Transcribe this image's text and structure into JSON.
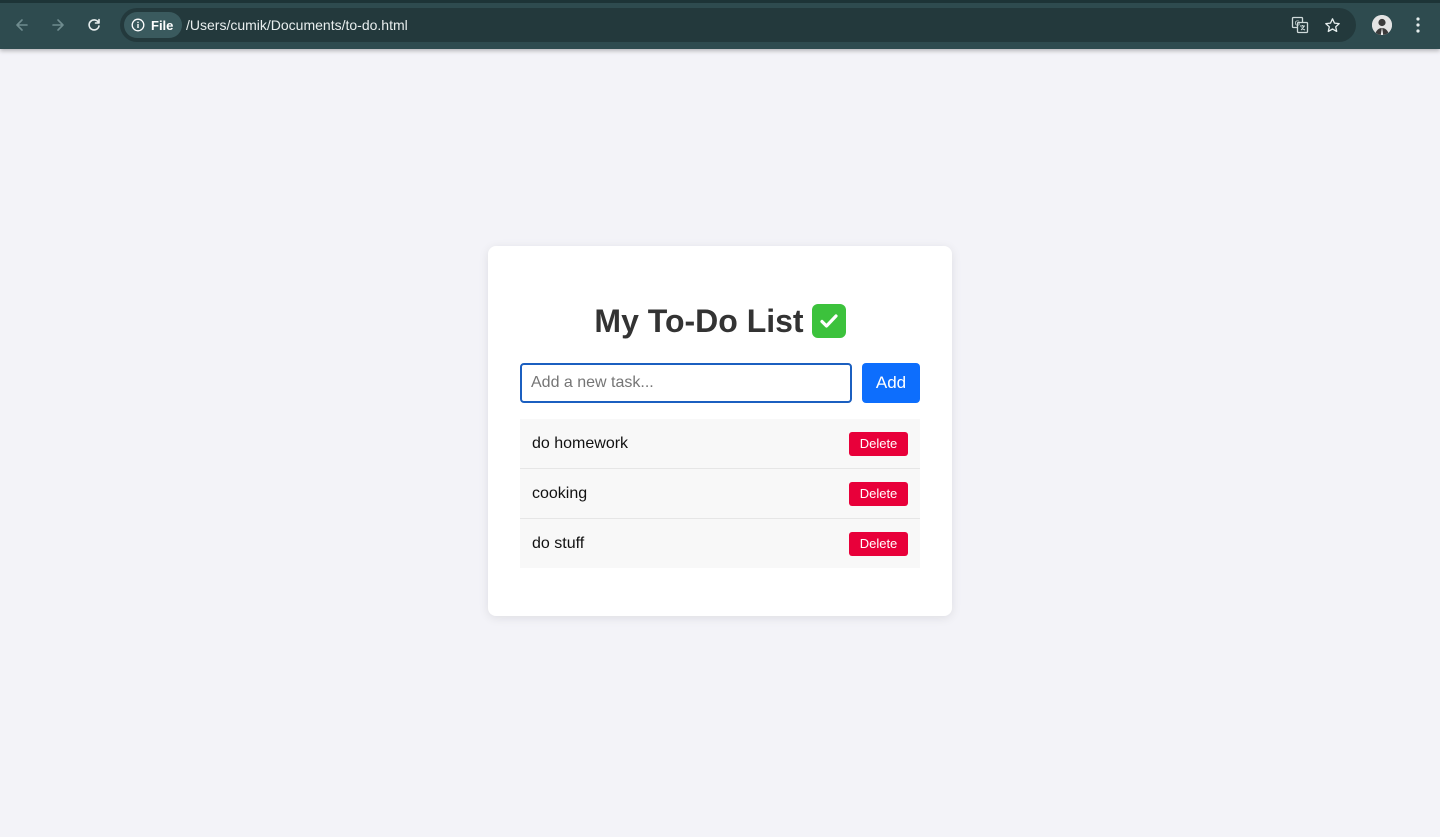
{
  "browser": {
    "site_chip_label": "File",
    "url": "/Users/cumik/Documents/to-do.html",
    "icons": {
      "back": "arrow-left-icon",
      "forward": "arrow-right-icon",
      "reload": "reload-icon",
      "site_info": "info-icon",
      "translate": "translate-icon",
      "bookmark": "star-icon",
      "profile": "avatar",
      "menu": "kebab-menu-icon"
    },
    "colors": {
      "toolbar": "#2e4b4f",
      "address_bar": "#23393c"
    }
  },
  "app": {
    "title": "My To-Do List",
    "title_emoji": "✅",
    "input": {
      "value": "",
      "placeholder": "Add a new task..."
    },
    "add_label": "Add",
    "tasks": [
      {
        "text": "do homework",
        "delete_label": "Delete"
      },
      {
        "text": "cooking",
        "delete_label": "Delete"
      },
      {
        "text": "do stuff",
        "delete_label": "Delete"
      }
    ],
    "colors": {
      "page_background": "#f3f3f8",
      "add_button": "#0d6efd",
      "delete_button": "#e8003a",
      "input_border": "#1b5fc0"
    }
  }
}
